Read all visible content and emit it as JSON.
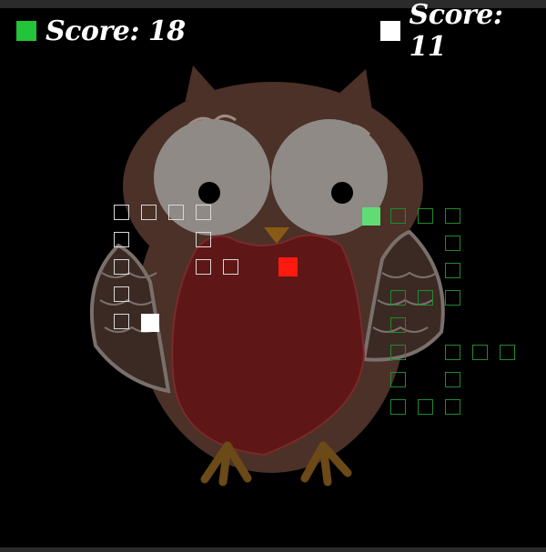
{
  "scoreboard": {
    "left": {
      "label": "Score: 18",
      "color": "#22c43a"
    },
    "right": {
      "label": "Score: 11",
      "color": "#ffffff"
    }
  },
  "colors": {
    "white_snake": "#d8d8d8",
    "white_head": "#ffffff",
    "green_snake": "#1f8a2e",
    "green_head": "#5fdc74",
    "food": "#ff1a10",
    "background": "#000000"
  },
  "board": {
    "background_image": "owl-icon",
    "white_snake_segments": 12,
    "green_snake_segments": 21,
    "food_count": 1
  }
}
